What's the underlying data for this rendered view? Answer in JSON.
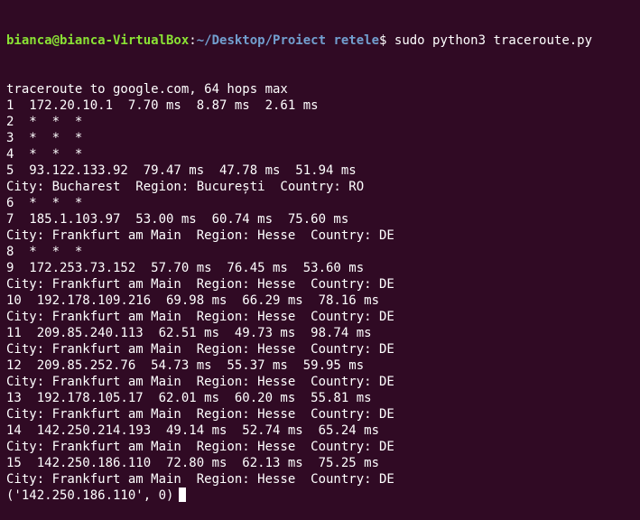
{
  "colors": {
    "background": "#300a24",
    "text": "#ffffff",
    "user_host": "#8ae234",
    "path": "#729fcf"
  },
  "prompt": {
    "user_host": "bianca@bianca-VirtualBox",
    "colon": ":",
    "path": "~/Desktop/Proiect retele",
    "symbol": "$ ",
    "command": "sudo python3 traceroute.py"
  },
  "output_lines": [
    "traceroute to google.com, 64 hops max",
    "1  172.20.10.1  7.70 ms  8.87 ms  2.61 ms",
    "2  *  *  *",
    "3  *  *  *",
    "4  *  *  *",
    "5  93.122.133.92  79.47 ms  47.78 ms  51.94 ms",
    "City: Bucharest  Region: București  Country: RO",
    "6  *  *  *",
    "7  185.1.103.97  53.00 ms  60.74 ms  75.60 ms",
    "City: Frankfurt am Main  Region: Hesse  Country: DE",
    "8  *  *  *",
    "9  172.253.73.152  57.70 ms  76.45 ms  53.60 ms",
    "City: Frankfurt am Main  Region: Hesse  Country: DE",
    "10  192.178.109.216  69.98 ms  66.29 ms  78.16 ms",
    "City: Frankfurt am Main  Region: Hesse  Country: DE",
    "11  209.85.240.113  62.51 ms  49.73 ms  98.74 ms",
    "City: Frankfurt am Main  Region: Hesse  Country: DE",
    "12  209.85.252.76  54.73 ms  55.37 ms  59.95 ms",
    "City: Frankfurt am Main  Region: Hesse  Country: DE",
    "13  192.178.105.17  62.01 ms  60.20 ms  55.81 ms",
    "City: Frankfurt am Main  Region: Hesse  Country: DE",
    "14  142.250.214.193  49.14 ms  52.74 ms  65.24 ms",
    "City: Frankfurt am Main  Region: Hesse  Country: DE",
    "15  142.250.186.110  72.80 ms  62.13 ms  75.25 ms",
    "City: Frankfurt am Main  Region: Hesse  Country: DE",
    "('142.250.186.110', 0)"
  ]
}
